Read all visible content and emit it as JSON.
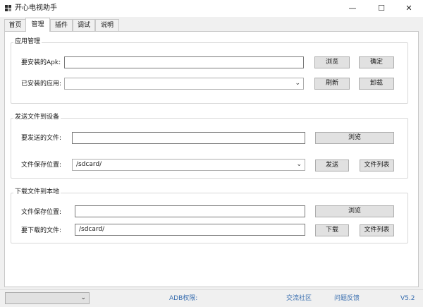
{
  "window": {
    "title": "开心电视助手",
    "minimize_glyph": "—",
    "maximize_glyph": "☐",
    "close_glyph": "✕"
  },
  "tabs": [
    {
      "label": "首页",
      "active": false
    },
    {
      "label": "管理",
      "active": true
    },
    {
      "label": "插件",
      "active": false
    },
    {
      "label": "调试",
      "active": false
    },
    {
      "label": "说明",
      "active": false
    }
  ],
  "app_management": {
    "legend": "应用管理",
    "install_label": "要安装的Apk:",
    "install_value": "",
    "browse_label": "浏览",
    "confirm_label": "确定",
    "installed_label": "已安装的应用:",
    "installed_value": "",
    "refresh_label": "刷新",
    "uninstall_label": "卸载"
  },
  "send_to_device": {
    "legend": "发送文件到设备",
    "file_label": "要发送的文件:",
    "file_value": "",
    "browse_label": "浏览",
    "save_location_label": "文件保存位置:",
    "save_location_value": "/sdcard/",
    "send_label": "发送",
    "file_list_label": "文件列表"
  },
  "download_local": {
    "legend": "下载文件到本地",
    "save_location_label": "文件保存位置:",
    "save_location_value": "",
    "browse_label": "浏览",
    "download_file_label": "要下载的文件:",
    "download_file_value": "/sdcard/",
    "download_label": "下载",
    "file_list_label": "文件列表"
  },
  "statusbar": {
    "adb_label": "ADB权限:",
    "community_link": "交流社区",
    "feedback_link": "问题反馈",
    "version": "V5.2"
  }
}
